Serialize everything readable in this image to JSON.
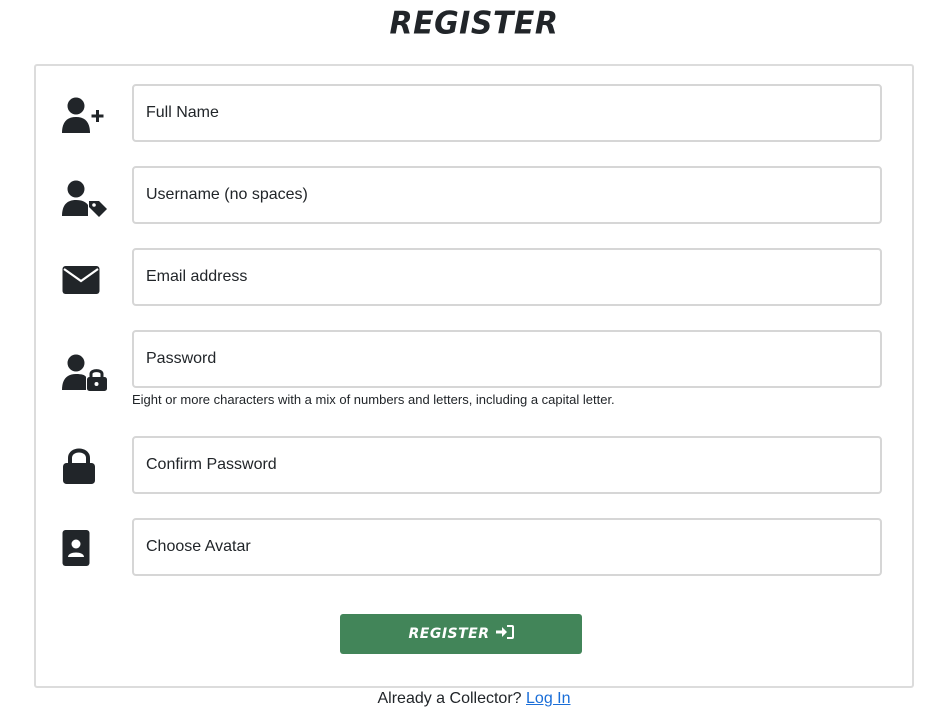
{
  "page": {
    "title": "REGISTER"
  },
  "form": {
    "full_name": {
      "placeholder": "Full Name",
      "icon": "user-plus-icon"
    },
    "username": {
      "placeholder": "Username (no spaces)",
      "icon": "user-tag-icon"
    },
    "email": {
      "placeholder": "Email address",
      "icon": "envelope-icon"
    },
    "password": {
      "placeholder": "Password",
      "icon": "user-lock-icon",
      "help": "Eight or more characters with a mix of numbers and letters, including a capital letter."
    },
    "confirm_password": {
      "placeholder": "Confirm Password",
      "icon": "lock-icon"
    },
    "avatar": {
      "placeholder": "Choose Avatar",
      "icon": "id-badge-icon"
    },
    "submit_label": "REGISTER"
  },
  "footer": {
    "prompt": "Already a Collector?",
    "login_link": "Log In"
  },
  "colors": {
    "button": "#428559",
    "link": "#1a6ed8",
    "text": "#212529"
  }
}
